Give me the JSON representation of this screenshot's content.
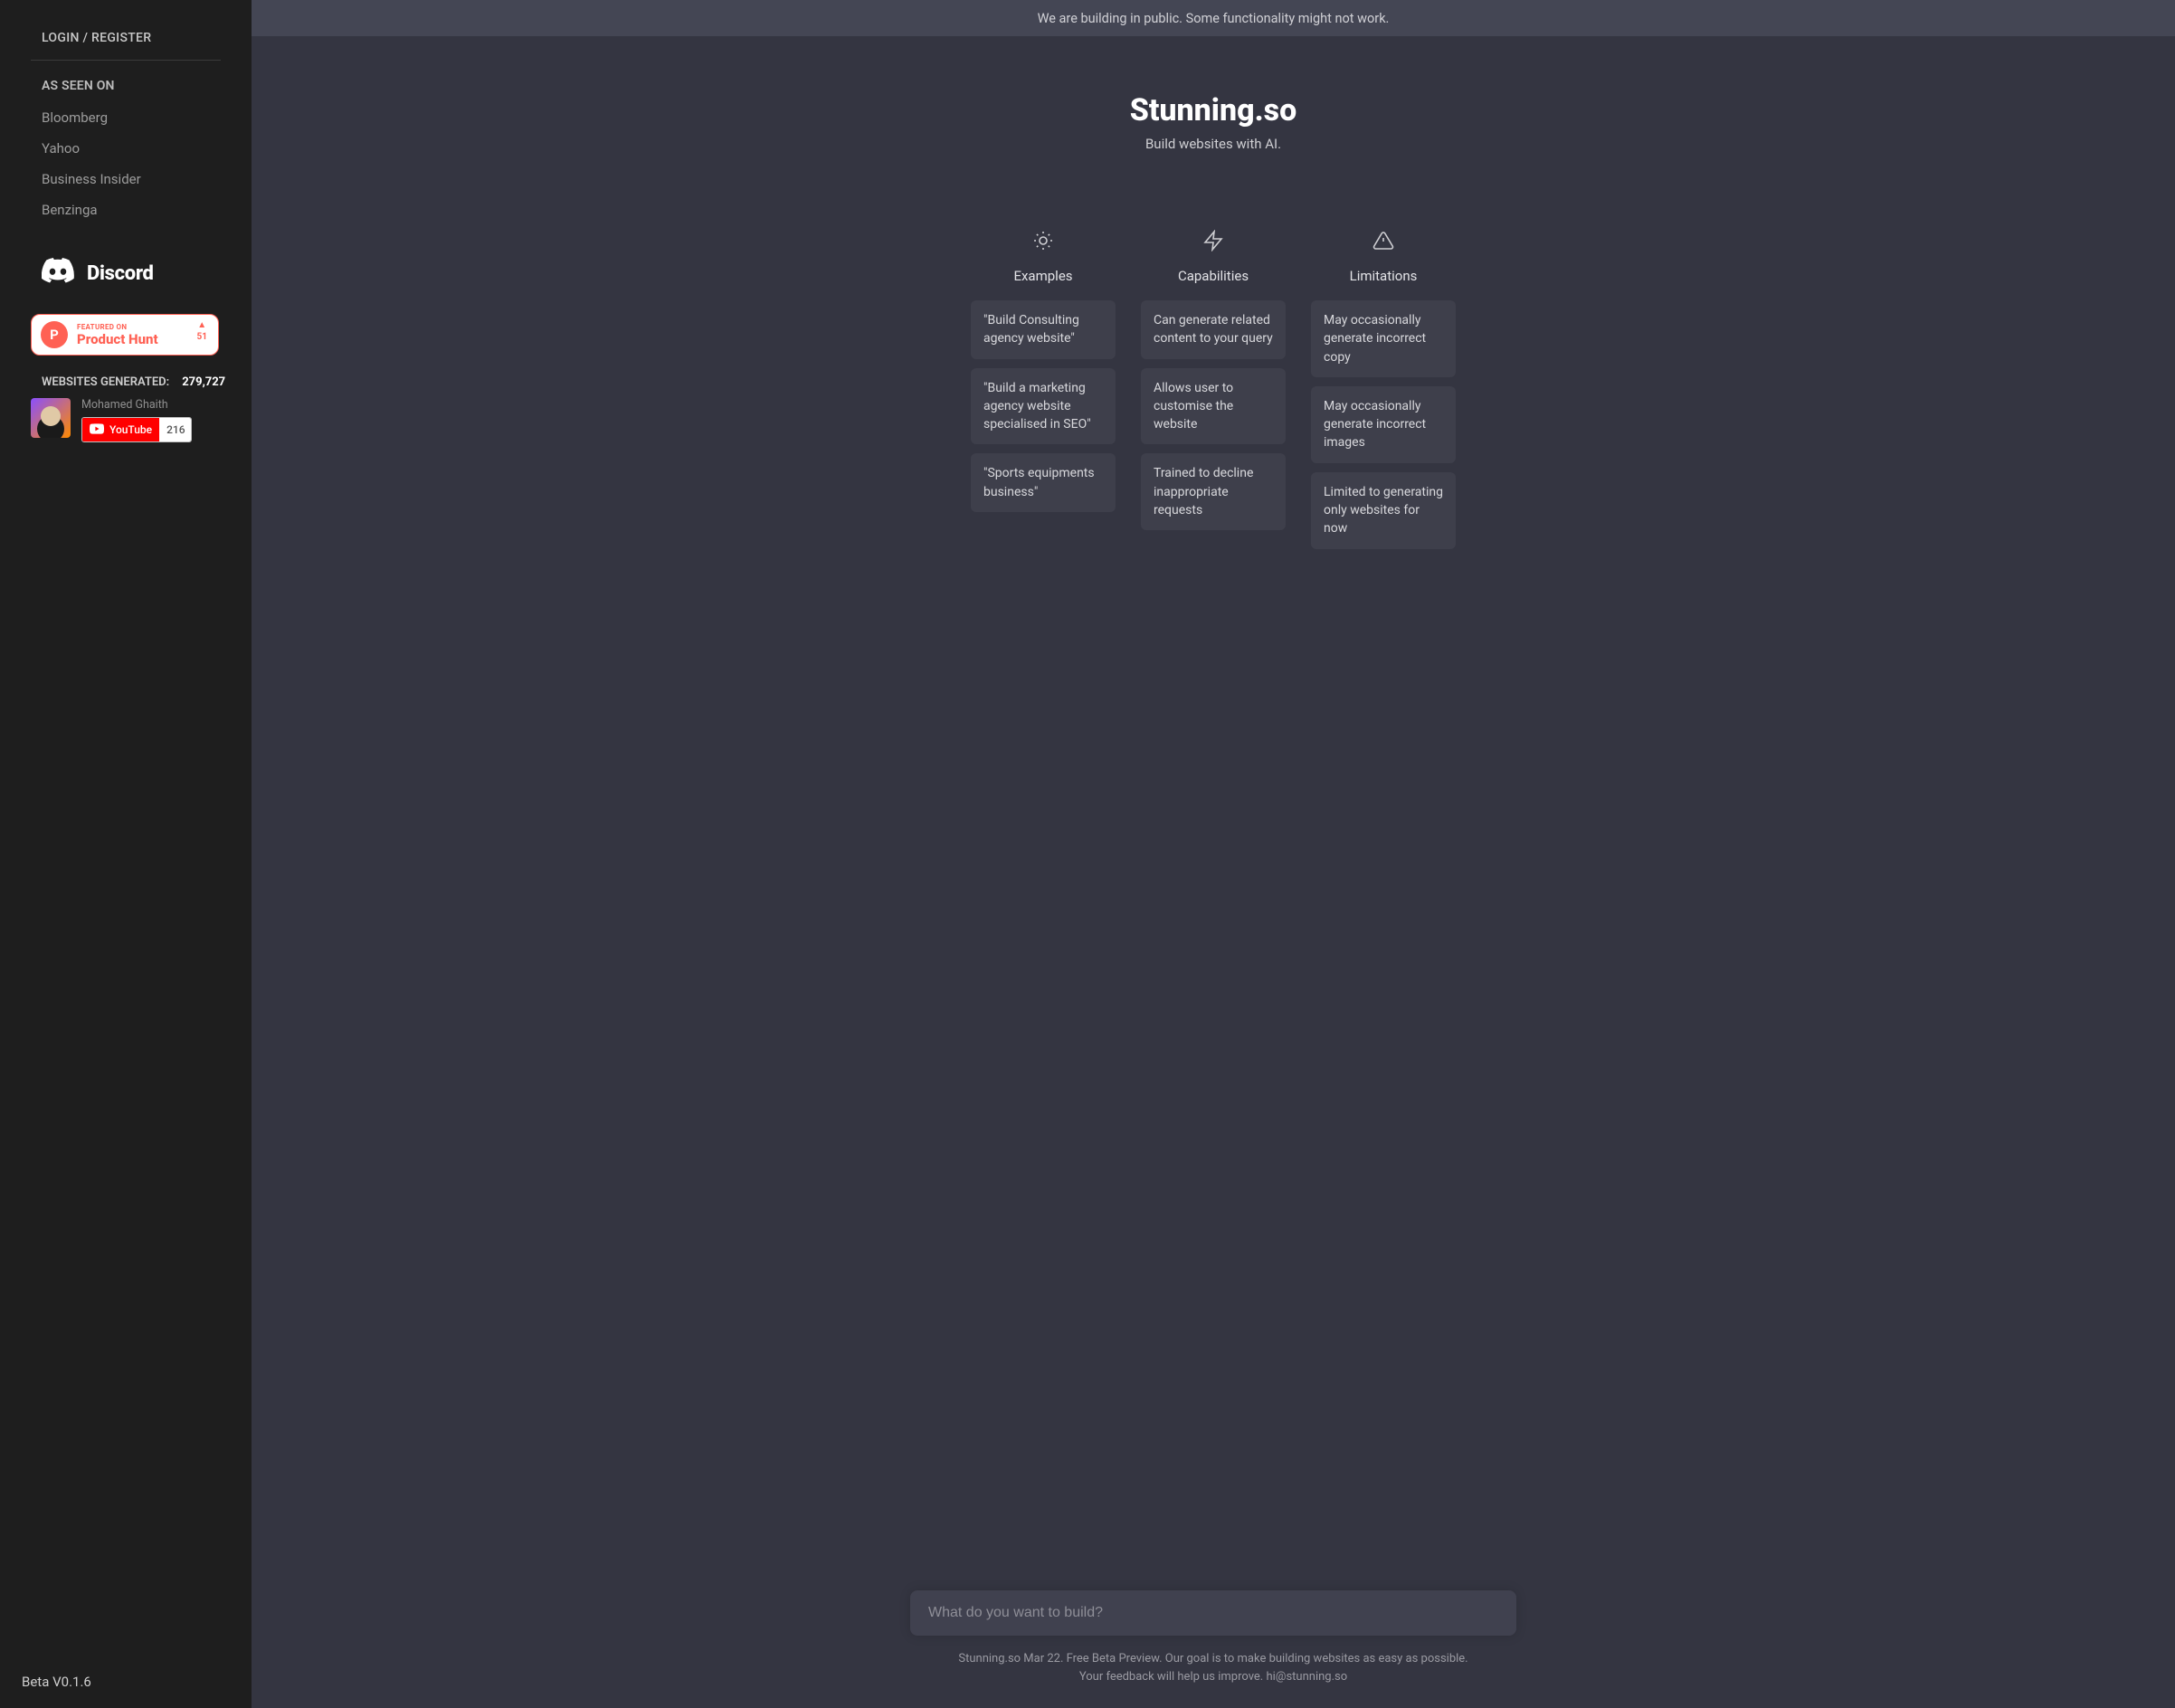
{
  "sidebar": {
    "login_label": "LOGIN / REGISTER",
    "as_seen_label": "AS SEEN ON",
    "press": [
      "Bloomberg",
      "Yahoo",
      "Business Insider",
      "Benzinga"
    ],
    "discord_label": "Discord",
    "product_hunt": {
      "featured_label": "FEATURED ON",
      "name": "Product Hunt",
      "upvotes": "51",
      "letter": "P"
    },
    "stats": {
      "label": "WEBSITES GENERATED:",
      "count": "279,727"
    },
    "profile": {
      "name": "Mohamed Ghaith"
    },
    "youtube": {
      "label": "YouTube",
      "count": "216"
    },
    "version": "Beta V0.1.6"
  },
  "main": {
    "banner": "We are building in public. Some functionality might not work.",
    "title": "Stunning.so",
    "subtitle": "Build websites with AI.",
    "columns": {
      "examples": {
        "heading": "Examples",
        "items": [
          "\"Build Consulting agency website\"",
          "\"Build a marketing agency website specialised in SEO\"",
          "\"Sports equipments business\""
        ]
      },
      "capabilities": {
        "heading": "Capabilities",
        "items": [
          "Can generate related content to your query",
          "Allows user to customise the website",
          "Trained to decline inappropriate requests"
        ]
      },
      "limitations": {
        "heading": "Limitations",
        "items": [
          "May occasionally generate incorrect copy",
          "May occasionally generate incorrect images",
          "Limited to generating only websites for now"
        ]
      }
    },
    "input_placeholder": "What do you want to build?",
    "footer_line1": "Stunning.so Mar 22. Free Beta Preview. Our goal is to make building websites as easy as possible.",
    "footer_line2": "Your feedback will help us improve. hi@stunning.so"
  }
}
